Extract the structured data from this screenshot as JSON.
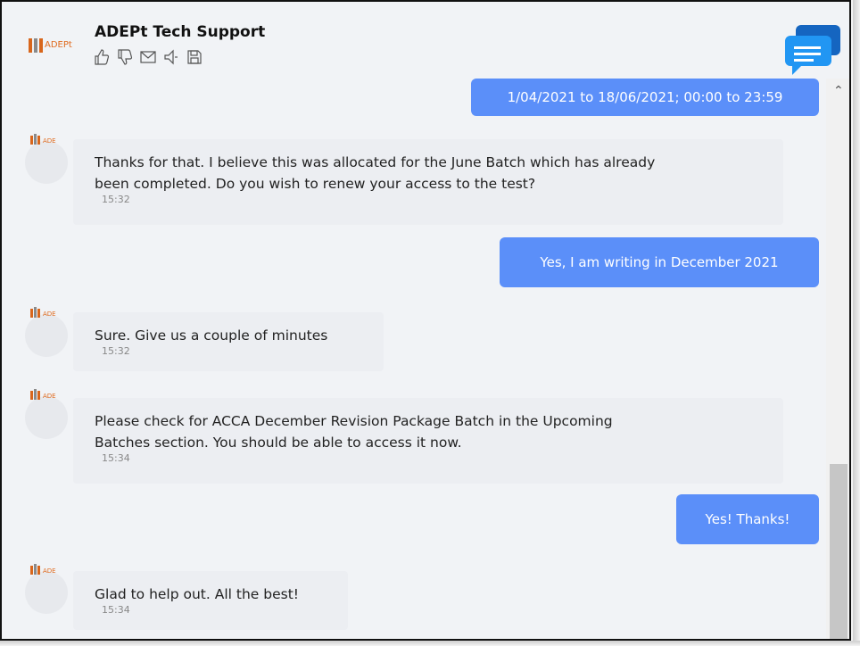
{
  "header": {
    "title": "ADEPt Tech Support",
    "logo_text": "ADEPt",
    "tools": [
      "thumbs-up-icon",
      "thumbs-down-icon",
      "envelope-icon",
      "speaker-icon",
      "save-icon"
    ]
  },
  "messages": [
    {
      "sender": "user",
      "text": "1/04/2021 to 18/06/2021; 00:00 to 23:59"
    },
    {
      "sender": "agent",
      "lines": [
        "Thanks for that. I believe this was allocated for the June Batch which has already",
        "been completed. Do you wish to renew your access to the test?"
      ],
      "time": "15:32"
    },
    {
      "sender": "user",
      "text": "Yes, I am writing in December 2021"
    },
    {
      "sender": "agent",
      "lines": [
        "Sure. Give us a couple of minutes"
      ],
      "time": "15:32"
    },
    {
      "sender": "agent",
      "lines": [
        "Please check for ACCA December Revision Package Batch in the Upcoming",
        "Batches section. You should be able to access it now."
      ],
      "time": "15:34"
    },
    {
      "sender": "user",
      "text": "Yes! Thanks!"
    },
    {
      "sender": "agent",
      "lines": [
        "Glad to help out. All the best!"
      ],
      "time": "15:34"
    }
  ],
  "colors": {
    "user_bubble": "#5b8ff9",
    "agent_bubble": "#eceef2",
    "accent": "#1e88e5"
  }
}
